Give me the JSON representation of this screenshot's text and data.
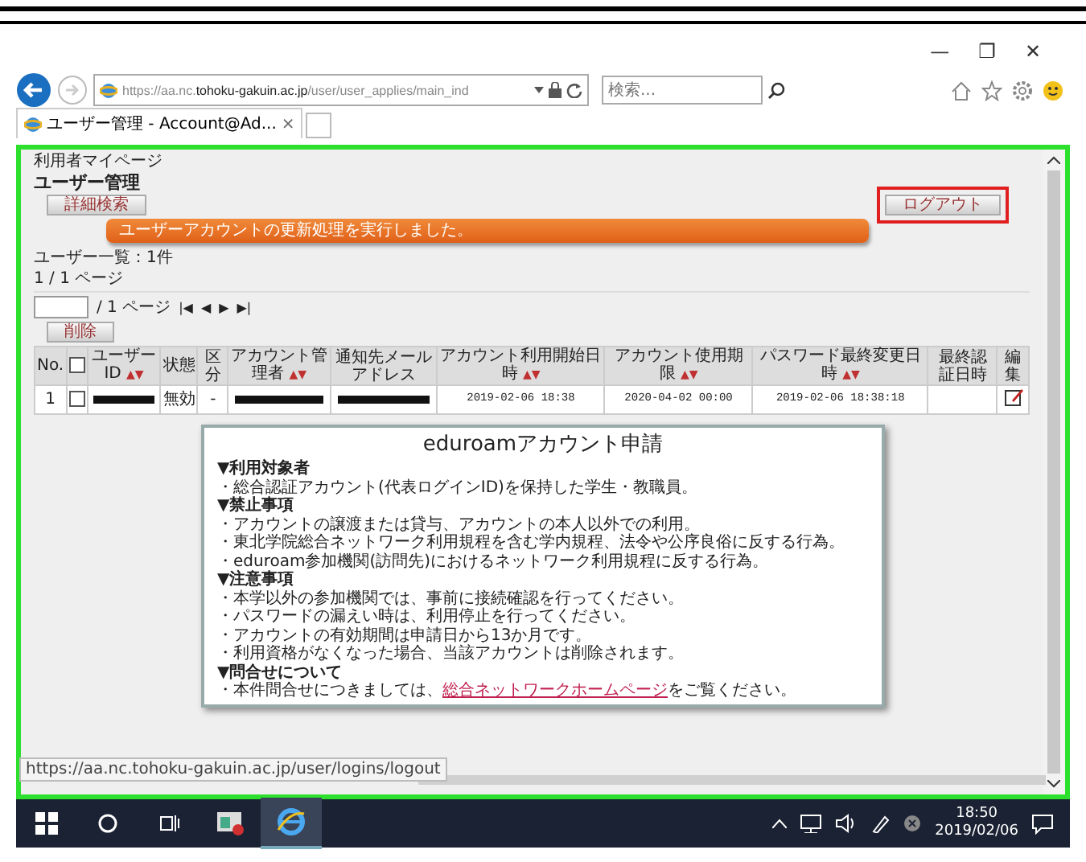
{
  "window_controls": {
    "minimize": "—",
    "maximize": "❐",
    "close": "✕"
  },
  "address_bar": {
    "prefix": "https://aa.nc.",
    "domain": "tohoku-gakuin.ac.jp",
    "path": "/user/user_applies/main_ind"
  },
  "search": {
    "placeholder": "検索..."
  },
  "tabs": [
    {
      "label": "ユーザー管理 - Account@Ad...",
      "close": "×",
      "selected": true
    }
  ],
  "page": {
    "breadcrumb": "利用者マイページ",
    "title": "ユーザー管理",
    "detail_search_button": "詳細検索",
    "logout_button": "ログアウト",
    "message": "ユーザーアカウントの更新処理を実行しました。",
    "count": "ユーザー一覧：1件",
    "pages": "1 / 1 ページ",
    "pager_total": "/ 1 ページ",
    "pager_links": [
      "|◀",
      "◀",
      "▶",
      "▶|"
    ],
    "delete_button": "削除"
  },
  "table": {
    "columns": [
      {
        "label": "No.",
        "kind": "text"
      },
      {
        "kind": "checkbox",
        "checked": false
      },
      {
        "label": "ユーザーID",
        "sort": "▲▼",
        "kind": "text"
      },
      {
        "label": "状態",
        "kind": "text"
      },
      {
        "label": "区分",
        "kind": "text"
      },
      {
        "label": "アカウント管理者",
        "sort": "▲▼",
        "kind": "text"
      },
      {
        "label": "通知先メールアドレス",
        "kind": "text"
      },
      {
        "label": "アカウント利用開始日時",
        "sort": "▲▼",
        "kind": "text"
      },
      {
        "label": "アカウント使用期限",
        "sort": "▲▼",
        "kind": "text"
      },
      {
        "label": "パスワード最終変更日時",
        "sort": "▲▼",
        "kind": "text"
      },
      {
        "label": "最終認証日時",
        "kind": "text"
      },
      {
        "label": "編集",
        "kind": "text"
      }
    ],
    "rows": [
      {
        "cells": [
          {
            "kind": "text",
            "text": "1"
          },
          {
            "kind": "checkbox",
            "checked": false
          },
          {
            "kind": "redacted"
          },
          {
            "kind": "text",
            "text": "無効"
          },
          {
            "kind": "text",
            "text": "-"
          },
          {
            "kind": "redacted"
          },
          {
            "kind": "redacted"
          },
          {
            "kind": "date",
            "text": "2019-02-06 18:38"
          },
          {
            "kind": "date",
            "text": "2020-04-02 00:00"
          },
          {
            "kind": "date",
            "text": "2019-02-06 18:38:18"
          },
          {
            "kind": "text",
            "text": ""
          },
          {
            "kind": "edit"
          }
        ]
      }
    ]
  },
  "dialog": {
    "title": "eduroamアカウント申請",
    "sections": [
      {
        "heading": "▼利用対象者",
        "lines": [
          "・総合認証アカウント(代表ログインID)を保持した学生・教職員。"
        ]
      },
      {
        "heading": "▼禁止事項",
        "lines": [
          "・アカウントの譲渡または貸与、アカウントの本人以外での利用。",
          "・東北学院総合ネットワーク利用規程を含む学内規程、法令や公序良俗に反する行為。",
          "・eduroam参加機関(訪問先)におけるネットワーク利用規程に反する行為。"
        ]
      },
      {
        "heading": "▼注意事項",
        "lines": [
          "・本学以外の参加機関では、事前に接続確認を行ってください。",
          "・パスワードの漏えい時は、利用停止を行ってください。",
          "・アカウントの有効期間は申請日から13か月です。",
          "・利用資格がなくなった場合、当該アカウントは削除されます。"
        ]
      },
      {
        "heading": "▼問合せについて",
        "link_line": {
          "before": "・本件問合せにつきましては、",
          "link": "総合ネットワークホームページ",
          "after": "をご覧ください。"
        }
      }
    ]
  },
  "status_url": "https://aa.nc.tohoku-gakuin.ac.jp/user/logins/logout",
  "taskbar": {
    "apps": [
      {
        "kind": "app",
        "selected": false
      },
      {
        "kind": "browser",
        "selected": true
      }
    ],
    "time": "18:50",
    "date": "2019/02/06"
  }
}
